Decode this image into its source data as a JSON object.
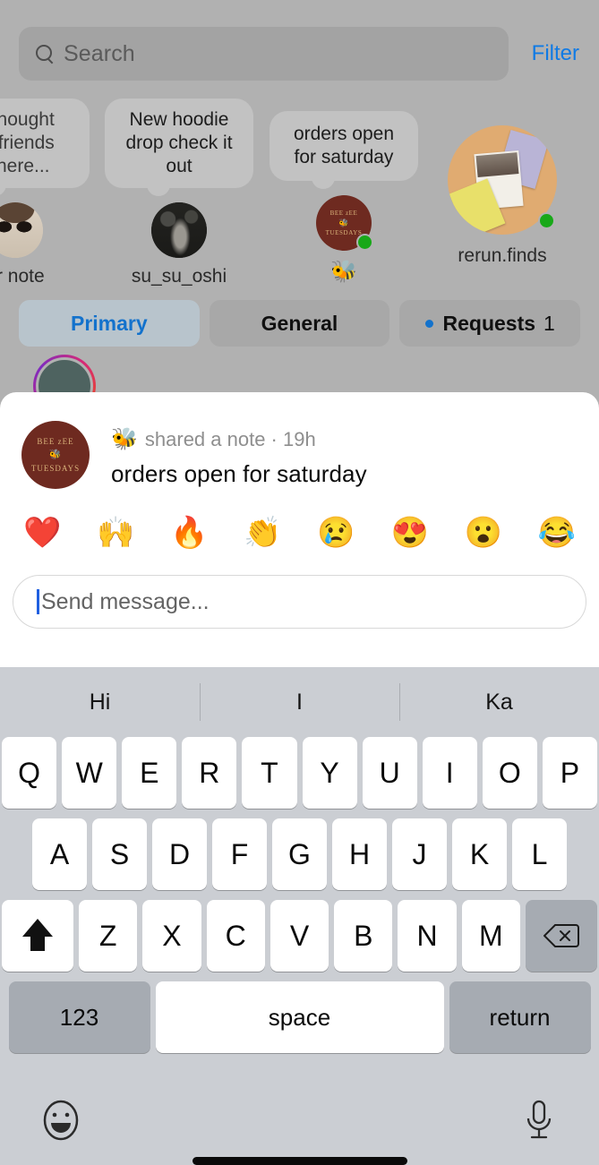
{
  "search": {
    "placeholder": "Search",
    "icon": "search-icon",
    "filter_label": "Filter"
  },
  "notes": [
    {
      "bubble": "a thought\nur friends\ne here...",
      "name": "ur note",
      "avatar": "your-note-avatar",
      "online": false
    },
    {
      "bubble": "New hoodie drop check it out",
      "name": "su_su_oshi",
      "avatar": "su-su-oshi-avatar",
      "online": false
    },
    {
      "bubble": "orders open for saturday",
      "name": "🐝",
      "avatar": "bee-zee-tuesdays-avatar",
      "online": true
    },
    {
      "bubble": "",
      "name": "rerun.finds",
      "avatar": "rerun-finds-avatar",
      "online": true
    }
  ],
  "tabs": [
    {
      "label": "Primary",
      "active": true,
      "dot": false,
      "count": ""
    },
    {
      "label": "General",
      "active": false,
      "dot": false,
      "count": ""
    },
    {
      "label": "Requests",
      "active": false,
      "dot": true,
      "count": "1"
    }
  ],
  "sheet": {
    "avatar_lines": [
      "BEE  zEE",
      "🐝",
      "TUESDAYS"
    ],
    "author_emoji": "🐝",
    "meta": "shared a note · 19h",
    "note_text": "orders open for saturday",
    "reactions": [
      "❤️",
      "🙌",
      "🔥",
      "👏",
      "😢",
      "😍",
      "😮",
      "😂"
    ],
    "input_placeholder": "Send message..."
  },
  "keyboard": {
    "suggestions": [
      "Hi",
      "I",
      "Ka"
    ],
    "row1": [
      "Q",
      "W",
      "E",
      "R",
      "T",
      "Y",
      "U",
      "I",
      "O",
      "P"
    ],
    "row2": [
      "A",
      "S",
      "D",
      "F",
      "G",
      "H",
      "J",
      "K",
      "L"
    ],
    "row3": [
      "Z",
      "X",
      "C",
      "V",
      "B",
      "N",
      "M"
    ],
    "shift_icon": "shift-icon",
    "backspace_icon": "backspace-icon",
    "numeric_label": "123",
    "space_label": "space",
    "return_label": "return",
    "emoji_icon": "emoji-keyboard-icon",
    "mic_icon": "microphone-icon"
  },
  "colors": {
    "accent_blue": "#1372cc",
    "filter_blue": "#0f7ae5",
    "online_green": "#18a818",
    "backdrop": "#b1b1b1",
    "sheet": "#ffffff",
    "keyboard_bg": "#cbced3",
    "avatar_brown": "#6e2a20"
  }
}
